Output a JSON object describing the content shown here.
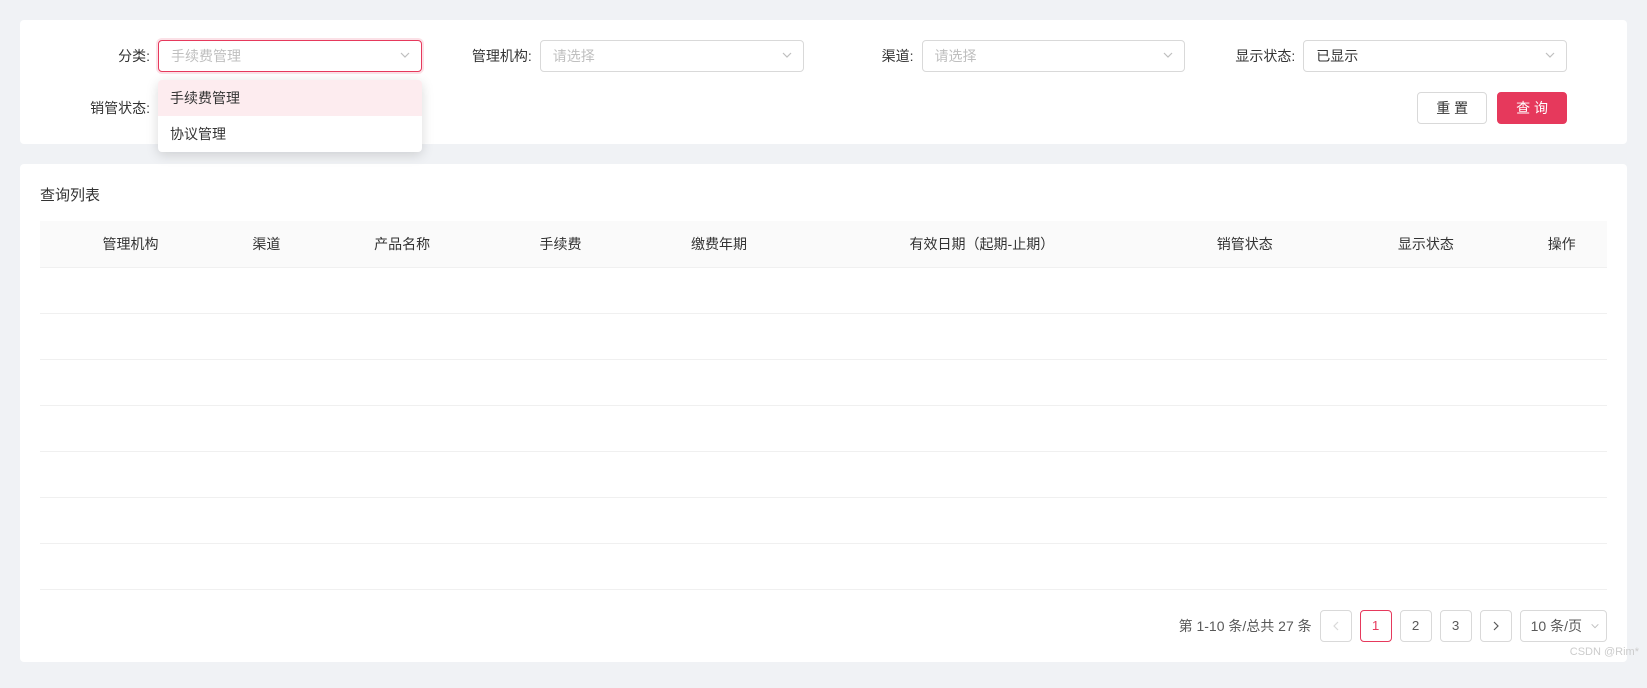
{
  "filters": {
    "category": {
      "label": "分类:",
      "value": "手续费管理",
      "options": [
        "手续费管理",
        "协议管理"
      ]
    },
    "org": {
      "label": "管理机构:",
      "placeholder": "请选择"
    },
    "channel": {
      "label": "渠道:",
      "placeholder": "请选择"
    },
    "display_status": {
      "label": "显示状态:",
      "value": "已显示"
    },
    "sale_status": {
      "label": "销管状态:",
      "placeholder": ""
    }
  },
  "buttons": {
    "reset": "重 置",
    "query": "查 询"
  },
  "list": {
    "title": "查询列表",
    "columns": [
      "管理机构",
      "渠道",
      "产品名称",
      "手续费",
      "缴费年期",
      "有效日期（起期-止期）",
      "销管状态",
      "显示状态",
      "操作"
    ]
  },
  "pagination": {
    "summary": "第 1-10 条/总共 27 条",
    "pages": [
      "1",
      "2",
      "3"
    ],
    "current": "1",
    "page_size": "10 条/页"
  },
  "watermark": "CSDN @Rim*"
}
